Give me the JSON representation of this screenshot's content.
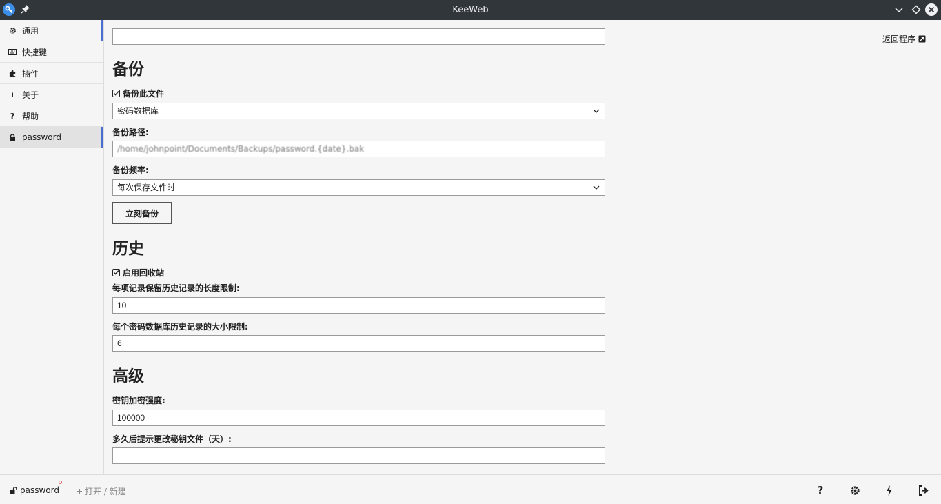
{
  "window": {
    "title": "KeeWeb"
  },
  "sidebar": {
    "items": [
      {
        "label": "通用",
        "icon": "gear-icon"
      },
      {
        "label": "快捷键",
        "icon": "keyboard-icon"
      },
      {
        "label": "插件",
        "icon": "puzzle-icon"
      },
      {
        "label": "关于",
        "icon": "info-icon"
      },
      {
        "label": "帮助",
        "icon": "question-icon"
      },
      {
        "label": "password",
        "icon": "lock-icon"
      }
    ]
  },
  "main": {
    "return_link": "返回程序",
    "top_field_value": "",
    "backup": {
      "heading": "备份",
      "checkbox_label": "备份此文件",
      "checkbox_checked": true,
      "location_value": "密码数据库",
      "path_label": "备份路径:",
      "path_value": "/home/johnpoint/Documents/Backups/password.{date}.bak",
      "frequency_label": "备份频率:",
      "frequency_value": "每次保存文件时",
      "backup_now_button": "立刻备份"
    },
    "history": {
      "heading": "历史",
      "recycle_label": "启用回收站",
      "recycle_checked": true,
      "max_items_label": "每项记录保留历史记录的长度限制:",
      "max_items_value": "10",
      "max_size_label": "每个密码数据库历史记录的大小限制:",
      "max_size_value": "6"
    },
    "advanced": {
      "heading": "高级",
      "key_strength_label": "密钥加密强度:",
      "key_strength_value": "100000",
      "key_change_label": "多久后提示更改秘钥文件（天）:",
      "key_change_value": ""
    }
  },
  "footer": {
    "file_name": "password",
    "open_new": "打开 / 新建",
    "icons": [
      "help-icon",
      "settings-icon",
      "lightning-icon",
      "logout-icon"
    ]
  }
}
